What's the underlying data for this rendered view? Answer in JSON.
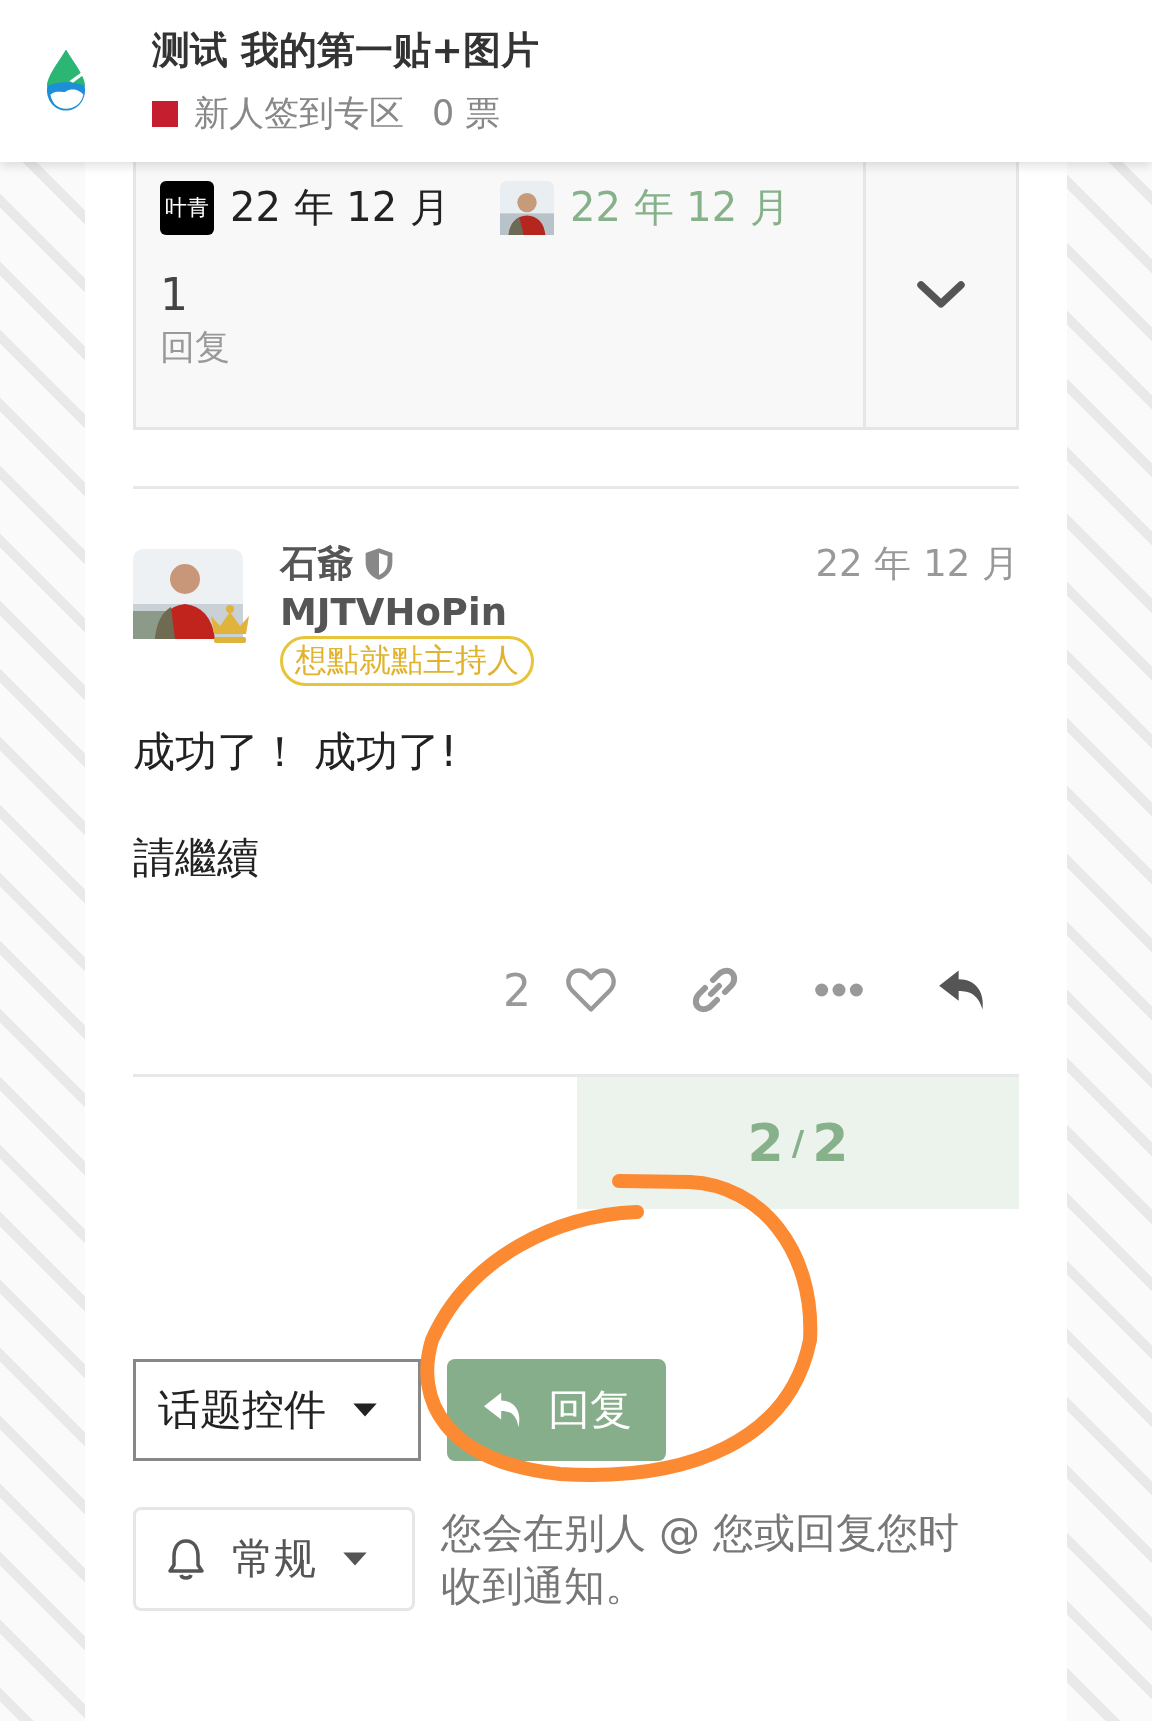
{
  "header": {
    "title": "测试 我的第一贴+图片",
    "category": {
      "name": "新人签到专区",
      "color": "#c41e2f"
    },
    "votes": "0 票"
  },
  "topic_map": {
    "created": {
      "avatar_text": "叶青",
      "date": "22 年 12 月"
    },
    "last_reply": {
      "date": "22 年 12 月"
    },
    "replies": {
      "count": "1",
      "label": "回复"
    },
    "expanded": false
  },
  "post": {
    "name": "石爺",
    "username": "MJTVHoPin",
    "flair": "想點就點主持人",
    "date": "22 年 12 月",
    "paragraphs": [
      "成功了！ 成功了!",
      "請繼續"
    ],
    "like_count": "2"
  },
  "progress": {
    "current": "2",
    "separator": "/",
    "total": "2"
  },
  "controls": {
    "topic_controls": "话题控件",
    "reply": "回复",
    "notification": {
      "level": "常规",
      "description": "您会在别人 @ 您或回复您时收到通知。"
    }
  }
}
